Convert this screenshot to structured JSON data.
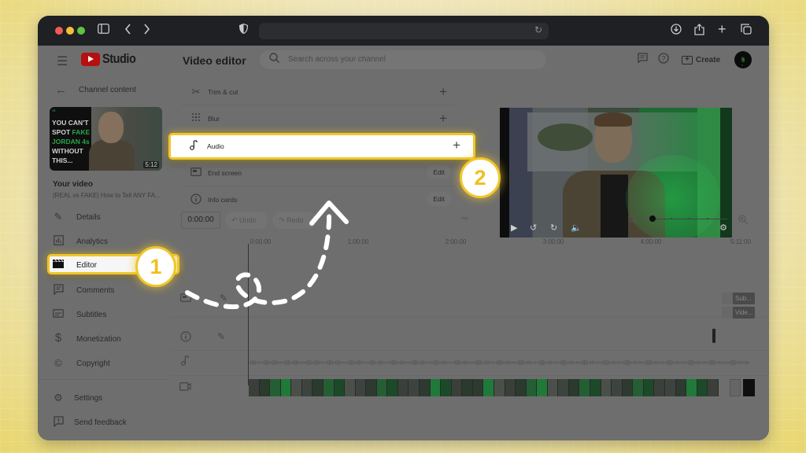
{
  "browser": {
    "url_bar": "",
    "buttons": {
      "sidebar_toggle": "sidebar-icon",
      "back": "chevron-left-icon",
      "forward": "chevron-right-icon",
      "privacy": "shield-icon",
      "reload": "reload-icon",
      "downloads": "download-icon",
      "share": "share-icon",
      "new_tab": "plus-icon",
      "tabs_overview": "tabs-icon"
    }
  },
  "header": {
    "logo_text": "Studio",
    "search_placeholder": "Search across your channel",
    "create_label": "Create"
  },
  "sidebar": {
    "back_label": "Channel content",
    "thumbnail": {
      "quote_mark": "“",
      "lines": [
        "YOU CAN'T",
        "SPOT",
        "FAKE",
        "JORDAN 4s",
        "WITHOUT",
        "THIS..."
      ],
      "duration": "5:12"
    },
    "your_video_label": "Your video",
    "video_title": "(REAL vs FAKE) How to Tell ANY FA...",
    "items": [
      {
        "label": "Details",
        "icon": "pencil-icon"
      },
      {
        "label": "Analytics",
        "icon": "analytics-icon"
      },
      {
        "label": "Editor",
        "icon": "clapperboard-icon",
        "active": true
      },
      {
        "label": "Comments",
        "icon": "comments-icon"
      },
      {
        "label": "Subtitles",
        "icon": "subtitles-icon"
      },
      {
        "label": "Monetization",
        "icon": "dollar-icon"
      },
      {
        "label": "Copyright",
        "icon": "copyright-icon"
      }
    ],
    "footer_items": [
      {
        "label": "Settings",
        "icon": "gear-icon"
      },
      {
        "label": "Send feedback",
        "icon": "feedback-icon"
      }
    ]
  },
  "editor": {
    "title": "Video editor",
    "tools": [
      {
        "label": "Trim & cut",
        "action": "+",
        "icon": "scissors-icon"
      },
      {
        "label": "Blur",
        "action": "+",
        "icon": "blur-icon"
      },
      {
        "label": "Audio",
        "action": "+",
        "icon": "music-note-icon",
        "highlighted": true
      },
      {
        "label": "End screen",
        "action": "Edit",
        "icon": "end-screen-icon"
      },
      {
        "label": "Info cards",
        "action": "Edit",
        "icon": "info-icon"
      }
    ],
    "timecode": "0:00:00",
    "undo_label": "Undo",
    "redo_label": "Redo",
    "zoom_level": 0,
    "ruler": [
      "0:00:00",
      "1:00:00",
      "2:00:00",
      "3:00:00",
      "4:00:00",
      "5:11:00"
    ],
    "chips": [
      "Sub...",
      "Vide..."
    ]
  },
  "annotations": {
    "step1": "1",
    "step2": "2",
    "accent_color": "#f0c62a"
  }
}
